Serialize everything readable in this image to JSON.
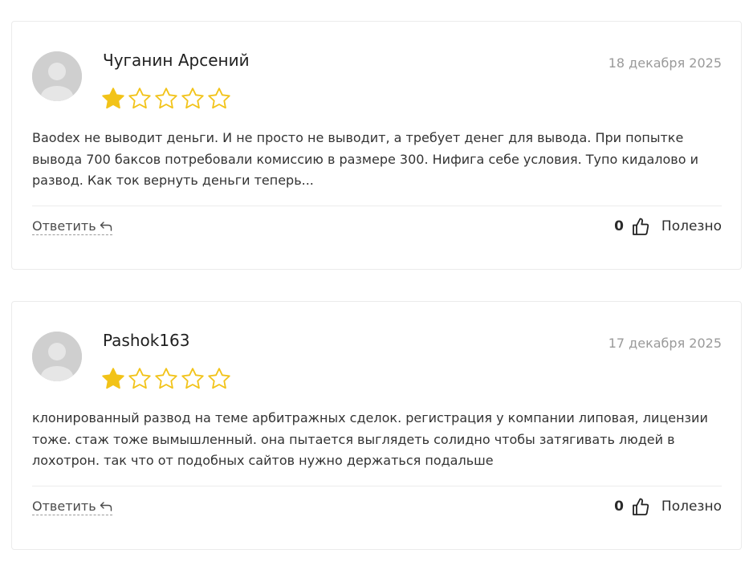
{
  "reviews": [
    {
      "author": "Чуганин Арсений",
      "date": "18 декабря 2025",
      "rating": 1,
      "max_rating": 5,
      "text": "Baodex не выводит деньги. И не просто не выводит, а требует денег для вывода. При попытке вывода 700 баксов потребовали комиссию в размере 300. Нифига себе условия. Тупо кидалово и развод. Как ток вернуть деньги теперь...",
      "reply_label": "Ответить",
      "helpful_count": "0",
      "helpful_label": "Полезно"
    },
    {
      "author": "Pashok163",
      "date": "17 декабря 2025",
      "rating": 1,
      "max_rating": 5,
      "text": "клонированный развод на теме арбитражных сделок. регистрация у компании липовая, лицензии тоже. стаж тоже вымышленный. она пытается выглядеть солидно чтобы затягивать людей в лохотрон. так что от подобных сайтов нужно держаться подальше",
      "reply_label": "Ответить",
      "helpful_count": "0",
      "helpful_label": "Полезно"
    }
  ],
  "colors": {
    "star_filled": "#f2c318",
    "star_outline": "#f2c318",
    "date": "#9a9a9a",
    "avatar_bg": "#cfcfcf"
  },
  "icons": {
    "avatar": "user-silhouette",
    "star": "star-icon",
    "reply": "reply-arrow-icon",
    "helpful": "thumbs-up-icon"
  }
}
